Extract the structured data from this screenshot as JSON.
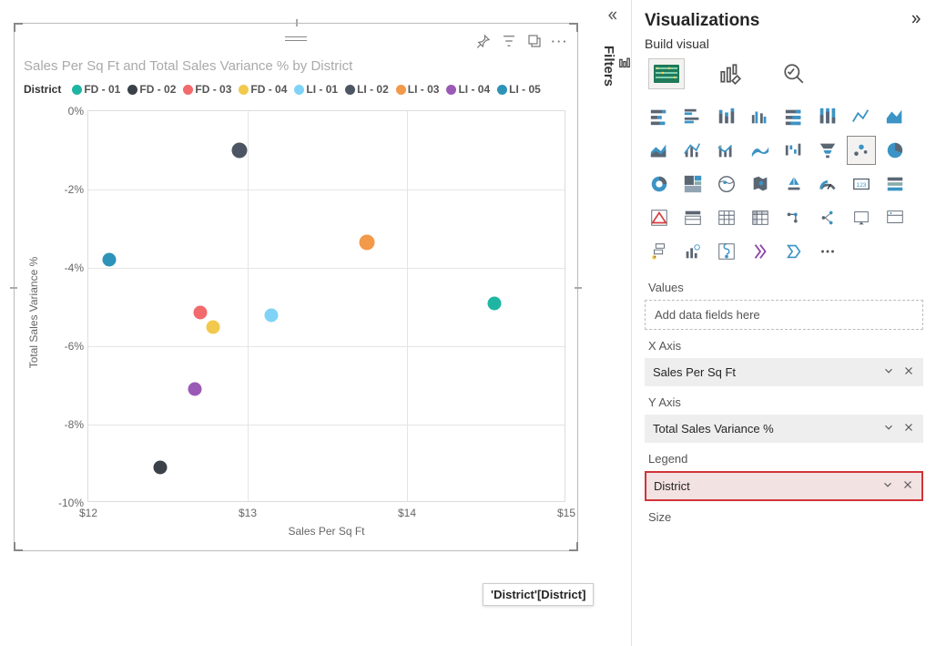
{
  "chart_data": {
    "type": "scatter",
    "title": "Sales Per Sq Ft and Total Sales Variance % by District",
    "xlabel": "Sales Per Sq Ft",
    "ylabel": "Total Sales Variance %",
    "xlim": [
      12,
      15
    ],
    "ylim": [
      -10,
      0
    ],
    "xticks": [
      "$12",
      "$13",
      "$14",
      "$15"
    ],
    "yticks": [
      "0%",
      "-2%",
      "-4%",
      "-6%",
      "-8%",
      "-10%"
    ],
    "legend_title": "District",
    "series": [
      {
        "name": "FD - 01",
        "color": "#1fb5a3",
        "x": 14.55,
        "y": -4.9,
        "size": 15
      },
      {
        "name": "FD - 02",
        "color": "#3a4149",
        "x": 12.45,
        "y": -9.1,
        "size": 15
      },
      {
        "name": "FD - 03",
        "color": "#f26a6c",
        "x": 12.7,
        "y": -5.15,
        "size": 15
      },
      {
        "name": "FD - 04",
        "color": "#f2c94c",
        "x": 12.78,
        "y": -5.5,
        "size": 15
      },
      {
        "name": "LI - 01",
        "color": "#7fd3f7",
        "x": 13.15,
        "y": -5.2,
        "size": 15
      },
      {
        "name": "LI - 02",
        "color": "#4c5662",
        "x": 12.95,
        "y": -1.0,
        "size": 17
      },
      {
        "name": "LI - 03",
        "color": "#f2994a",
        "x": 13.75,
        "y": -3.35,
        "size": 17
      },
      {
        "name": "LI - 04",
        "color": "#9b59b6",
        "x": 12.67,
        "y": -7.1,
        "size": 15
      },
      {
        "name": "LI - 05",
        "color": "#2e93b8",
        "x": 12.13,
        "y": -3.8,
        "size": 15
      }
    ]
  },
  "tooltip": "'District'[District]",
  "panel": {
    "title": "Visualizations",
    "subtitle": "Build visual",
    "filters_label": "Filters",
    "sections": {
      "values": {
        "label": "Values",
        "placeholder": "Add data fields here"
      },
      "xaxis": {
        "label": "X Axis",
        "value": "Sales Per Sq Ft"
      },
      "yaxis": {
        "label": "Y Axis",
        "value": "Total Sales Variance %"
      },
      "legend": {
        "label": "Legend",
        "value": "District"
      },
      "size": {
        "label": "Size"
      }
    }
  },
  "viz_icons": [
    "stacked-bar",
    "clustered-bar",
    "stacked-column",
    "clustered-column",
    "100-stacked-bar",
    "100-stacked-column",
    "line",
    "area",
    "stacked-area",
    "line-clustered",
    "line-stacked",
    "ribbon",
    "waterfall",
    "funnel",
    "scatter",
    "pie",
    "donut",
    "treemap",
    "map",
    "filled-map",
    "azure-map",
    "gauge",
    "card",
    "kpi",
    "multi-row",
    "slicer",
    "table",
    "matrix",
    "r-visual",
    "py-visual",
    "key-influencers",
    "decomp-tree",
    "qna",
    "narrative",
    "paginated",
    "power-apps",
    "power-automate",
    "more"
  ]
}
